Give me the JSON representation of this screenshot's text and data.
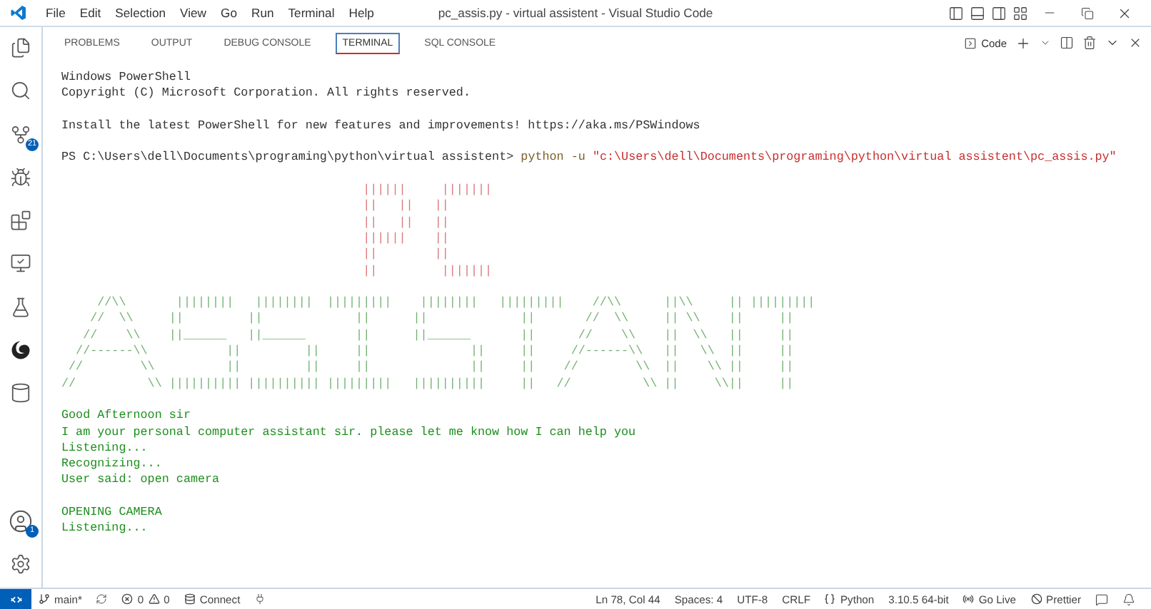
{
  "window": {
    "title": "pc_assis.py - virtual assistent - Visual Studio Code"
  },
  "menu": [
    "File",
    "Edit",
    "Selection",
    "View",
    "Go",
    "Run",
    "Terminal",
    "Help"
  ],
  "activity_bar": {
    "source_control_badge": "21",
    "accounts_badge": "1"
  },
  "panel": {
    "tabs": [
      {
        "label": "PROBLEMS",
        "selected": false
      },
      {
        "label": "OUTPUT",
        "selected": false
      },
      {
        "label": "DEBUG CONSOLE",
        "selected": false
      },
      {
        "label": "TERMINAL",
        "selected": true
      },
      {
        "label": "SQL CONSOLE",
        "selected": false
      }
    ],
    "terminal_name": "Code"
  },
  "terminal": {
    "lines": [
      {
        "kind": "plain",
        "text": "Windows PowerShell"
      },
      {
        "kind": "plain",
        "text": "Copyright (C) Microsoft Corporation. All rights reserved."
      },
      {
        "kind": "blank"
      },
      {
        "kind": "plain",
        "text": "Install the latest PowerShell for new features and improvements! https://aka.ms/PSWindows"
      },
      {
        "kind": "blank"
      },
      {
        "kind": "command",
        "prompt": "PS C:\\Users\\dell\\Documents\\programing\\python\\virtual assistent>",
        "command": "python -u",
        "argument": "\"c:\\Users\\dell\\Documents\\programing\\python\\virtual assistent\\pc_assis.py\""
      },
      {
        "kind": "blank"
      },
      {
        "kind": "banner",
        "color": "#d9787b",
        "text": "                                          ||||||     |||||||"
      },
      {
        "kind": "banner",
        "color": "#d9787b",
        "text": "                                          ||   ||   ||"
      },
      {
        "kind": "banner",
        "color": "#d9787b",
        "text": "                                          ||   ||   ||"
      },
      {
        "kind": "banner",
        "color": "#d9787b",
        "text": "                                          ||||||    ||"
      },
      {
        "kind": "banner",
        "color": "#d9787b",
        "text": "                                          ||        ||"
      },
      {
        "kind": "banner",
        "color": "#d9787b",
        "text": "                                          ||         |||||||"
      },
      {
        "kind": "blank"
      },
      {
        "kind": "banner",
        "color": "#74b374",
        "text": "     //\\\\       ||||||||   ||||||||  |||||||||    ||||||||   |||||||||    //\\\\      ||\\\\     || |||||||||"
      },
      {
        "kind": "banner",
        "color": "#74b374",
        "text": "    //  \\\\     ||         ||             ||      ||             ||       //  \\\\     || \\\\    ||     ||"
      },
      {
        "kind": "banner",
        "color": "#74b374",
        "text": "   //    \\\\    ||______   ||______       ||      ||______       ||      //    \\\\    ||  \\\\   ||     ||"
      },
      {
        "kind": "banner",
        "color": "#74b374",
        "text": "  //------\\\\           ||         ||     ||              ||     ||     //------\\\\   ||   \\\\  ||     ||"
      },
      {
        "kind": "banner",
        "color": "#74b374",
        "text": " //        \\\\          ||         ||     ||              ||     ||    //        \\\\  ||    \\\\ ||     ||"
      },
      {
        "kind": "banner",
        "color": "#74b374",
        "text": "//          \\\\ |||||||||| |||||||||| |||||||||   ||||||||||     ||   //          \\\\ ||     \\\\||     ||"
      },
      {
        "kind": "blank"
      },
      {
        "kind": "output",
        "text": "Good Afternoon sir"
      },
      {
        "kind": "output",
        "text": "I am your personal computer assistant sir. please let me know how I can help you"
      },
      {
        "kind": "output",
        "text": "Listening..."
      },
      {
        "kind": "output",
        "text": "Recognizing..."
      },
      {
        "kind": "output",
        "text": "User said: open camera"
      },
      {
        "kind": "blank"
      },
      {
        "kind": "output",
        "text": "OPENING CAMERA"
      },
      {
        "kind": "output",
        "text": "Listening..."
      }
    ]
  },
  "status_bar": {
    "branch": "main*",
    "errors": "0",
    "warnings": "0",
    "connect": "Connect",
    "right": [
      {
        "kind": "text",
        "text": "Ln 78, Col 44"
      },
      {
        "kind": "text",
        "text": "Spaces: 4"
      },
      {
        "kind": "text",
        "text": "UTF-8"
      },
      {
        "kind": "text",
        "text": "CRLF"
      },
      {
        "kind": "language",
        "text": "Python"
      },
      {
        "kind": "text",
        "text": "3.10.5 64-bit"
      },
      {
        "kind": "live",
        "text": "Go Live"
      },
      {
        "kind": "prettier",
        "text": "Prettier"
      }
    ]
  }
}
